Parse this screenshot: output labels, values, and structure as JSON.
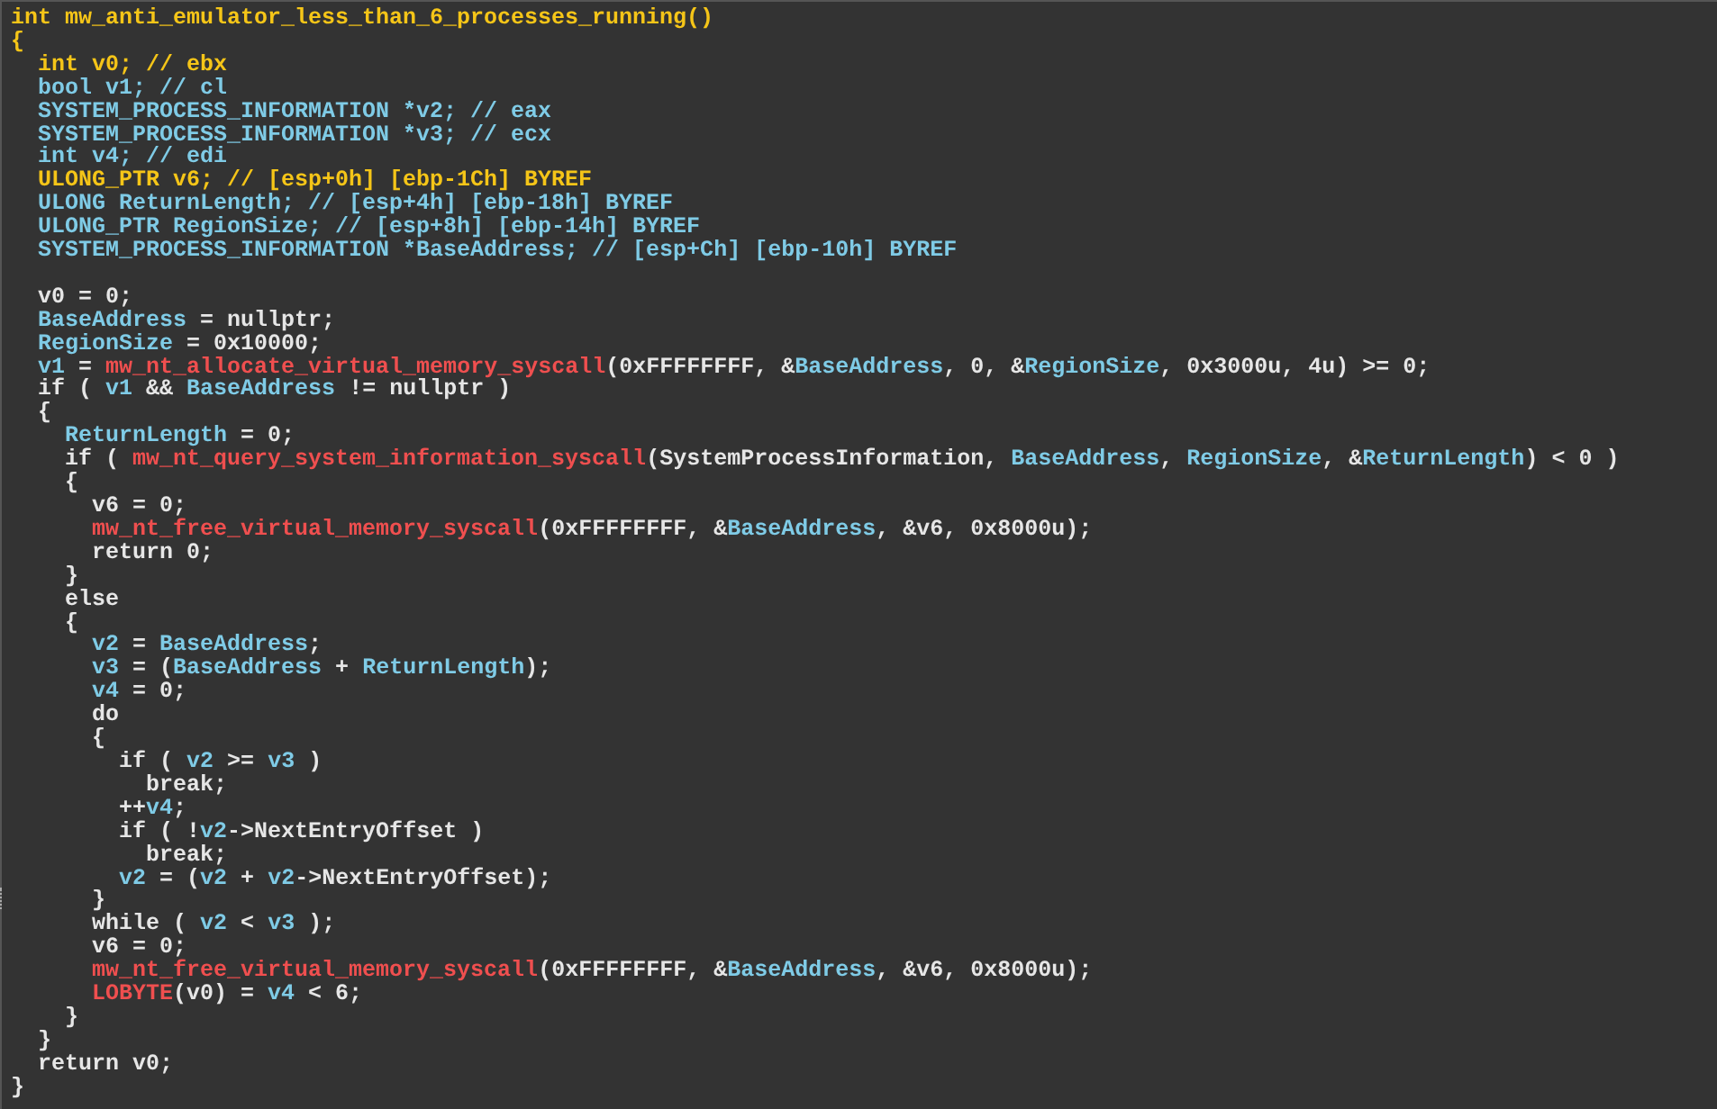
{
  "declarations": [
    [
      {
        "kind": "hl",
        "text": "int mw_anti_emulator_less_than_6_processes_running()"
      }
    ],
    [
      {
        "kind": "hl",
        "text": "{"
      }
    ],
    [
      {
        "kind": "hl",
        "text": "  int v0; // ebx"
      }
    ],
    [
      {
        "kind": "var",
        "text": "  bool v1; // cl"
      }
    ],
    [
      {
        "kind": "var",
        "text": "  SYSTEM_PROCESS_INFORMATION *v2; // eax"
      }
    ],
    [
      {
        "kind": "var",
        "text": "  SYSTEM_PROCESS_INFORMATION *v3; // ecx"
      }
    ],
    [
      {
        "kind": "var",
        "text": "  int v4; // edi"
      }
    ],
    [
      {
        "kind": "hl",
        "text": "  ULONG_PTR v6; // [esp+0h] [ebp-1Ch] BYREF"
      }
    ],
    [
      {
        "kind": "var",
        "text": "  ULONG ReturnLength; // [esp+4h] [ebp-18h] BYREF"
      }
    ],
    [
      {
        "kind": "var",
        "text": "  ULONG_PTR RegionSize; // [esp+8h] [ebp-14h] BYREF"
      }
    ],
    [
      {
        "kind": "var",
        "text": "  SYSTEM_PROCESS_INFORMATION *BaseAddress; // [esp+Ch] [ebp-10h] BYREF"
      }
    ]
  ],
  "body": [
    [
      {
        "kind": "plain",
        "text": "  v0 = 0;"
      }
    ],
    [
      {
        "kind": "var",
        "text": "  BaseAddress"
      },
      {
        "kind": "plain",
        "text": " = nullptr;"
      }
    ],
    [
      {
        "kind": "var",
        "text": "  RegionSize"
      },
      {
        "kind": "plain",
        "text": " = 0x10000;"
      }
    ],
    [
      {
        "kind": "var",
        "text": "  v1"
      },
      {
        "kind": "plain",
        "text": " = "
      },
      {
        "kind": "call",
        "text": "mw_nt_allocate_virtual_memory_syscall"
      },
      {
        "kind": "plain",
        "text": "(0xFFFFFFFF, &"
      },
      {
        "kind": "var",
        "text": "BaseAddress"
      },
      {
        "kind": "plain",
        "text": ", 0, &"
      },
      {
        "kind": "var",
        "text": "RegionSize"
      },
      {
        "kind": "plain",
        "text": ", 0x3000u, 4u) >= 0;"
      }
    ],
    [
      {
        "kind": "plain",
        "text": "  if ( "
      },
      {
        "kind": "var",
        "text": "v1"
      },
      {
        "kind": "plain",
        "text": " && "
      },
      {
        "kind": "var",
        "text": "BaseAddress"
      },
      {
        "kind": "plain",
        "text": " != nullptr )"
      }
    ],
    [
      {
        "kind": "plain",
        "text": "  {"
      }
    ],
    [
      {
        "kind": "var",
        "text": "    ReturnLength"
      },
      {
        "kind": "plain",
        "text": " = 0;"
      }
    ],
    [
      {
        "kind": "plain",
        "text": "    if ( "
      },
      {
        "kind": "call",
        "text": "mw_nt_query_system_information_syscall"
      },
      {
        "kind": "plain",
        "text": "(SystemProcessInformation, "
      },
      {
        "kind": "var",
        "text": "BaseAddress"
      },
      {
        "kind": "plain",
        "text": ", "
      },
      {
        "kind": "var",
        "text": "RegionSize"
      },
      {
        "kind": "plain",
        "text": ", &"
      },
      {
        "kind": "var",
        "text": "ReturnLength"
      },
      {
        "kind": "plain",
        "text": ") < 0 )"
      }
    ],
    [
      {
        "kind": "plain",
        "text": "    {"
      }
    ],
    [
      {
        "kind": "plain",
        "text": "      v6 = 0;"
      }
    ],
    [
      {
        "kind": "call",
        "text": "      mw_nt_free_virtual_memory_syscall"
      },
      {
        "kind": "plain",
        "text": "(0xFFFFFFFF, &"
      },
      {
        "kind": "var",
        "text": "BaseAddress"
      },
      {
        "kind": "plain",
        "text": ", &v6, 0x8000u);"
      }
    ],
    [
      {
        "kind": "plain",
        "text": "      return 0;"
      }
    ],
    [
      {
        "kind": "plain",
        "text": "    }"
      }
    ],
    [
      {
        "kind": "plain",
        "text": "    else"
      }
    ],
    [
      {
        "kind": "plain",
        "text": "    {"
      }
    ],
    [
      {
        "kind": "var",
        "text": "      v2"
      },
      {
        "kind": "plain",
        "text": " = "
      },
      {
        "kind": "var",
        "text": "BaseAddress"
      },
      {
        "kind": "plain",
        "text": ";"
      }
    ],
    [
      {
        "kind": "var",
        "text": "      v3"
      },
      {
        "kind": "plain",
        "text": " = ("
      },
      {
        "kind": "var",
        "text": "BaseAddress"
      },
      {
        "kind": "plain",
        "text": " + "
      },
      {
        "kind": "var",
        "text": "ReturnLength"
      },
      {
        "kind": "plain",
        "text": ");"
      }
    ],
    [
      {
        "kind": "var",
        "text": "      v4"
      },
      {
        "kind": "plain",
        "text": " = 0;"
      }
    ],
    [
      {
        "kind": "plain",
        "text": "      do"
      }
    ],
    [
      {
        "kind": "plain",
        "text": "      {"
      }
    ],
    [
      {
        "kind": "plain",
        "text": "        if ( "
      },
      {
        "kind": "var",
        "text": "v2"
      },
      {
        "kind": "plain",
        "text": " >= "
      },
      {
        "kind": "var",
        "text": "v3"
      },
      {
        "kind": "plain",
        "text": " )"
      }
    ],
    [
      {
        "kind": "plain",
        "text": "          break;"
      }
    ],
    [
      {
        "kind": "plain",
        "text": "        ++"
      },
      {
        "kind": "var",
        "text": "v4"
      },
      {
        "kind": "plain",
        "text": ";"
      }
    ],
    [
      {
        "kind": "plain",
        "text": "        if ( !"
      },
      {
        "kind": "var",
        "text": "v2"
      },
      {
        "kind": "plain",
        "text": "->NextEntryOffset )"
      }
    ],
    [
      {
        "kind": "plain",
        "text": "          break;"
      }
    ],
    [
      {
        "kind": "var",
        "text": "        v2"
      },
      {
        "kind": "plain",
        "text": " = ("
      },
      {
        "kind": "var",
        "text": "v2"
      },
      {
        "kind": "plain",
        "text": " + "
      },
      {
        "kind": "var",
        "text": "v2"
      },
      {
        "kind": "plain",
        "text": "->NextEntryOffset);"
      }
    ],
    [
      {
        "kind": "plain",
        "text": "      }"
      }
    ],
    [
      {
        "kind": "plain",
        "text": "      while ( "
      },
      {
        "kind": "var",
        "text": "v2"
      },
      {
        "kind": "plain",
        "text": " < "
      },
      {
        "kind": "var",
        "text": "v3"
      },
      {
        "kind": "plain",
        "text": " );"
      }
    ],
    [
      {
        "kind": "plain",
        "text": "      v6 = 0;"
      }
    ],
    [
      {
        "kind": "call",
        "text": "      mw_nt_free_virtual_memory_syscall"
      },
      {
        "kind": "plain",
        "text": "(0xFFFFFFFF, &"
      },
      {
        "kind": "var",
        "text": "BaseAddress"
      },
      {
        "kind": "plain",
        "text": ", &v6, 0x8000u);"
      }
    ],
    [
      {
        "kind": "call",
        "text": "      LOBYTE"
      },
      {
        "kind": "plain",
        "text": "(v0) = "
      },
      {
        "kind": "var",
        "text": "v4"
      },
      {
        "kind": "plain",
        "text": " < 6;"
      }
    ],
    [
      {
        "kind": "plain",
        "text": "    }"
      }
    ],
    [
      {
        "kind": "plain",
        "text": "  }"
      }
    ],
    [
      {
        "kind": "plain",
        "text": "  return v0;"
      }
    ],
    [
      {
        "kind": "plain",
        "text": "}"
      }
    ]
  ]
}
